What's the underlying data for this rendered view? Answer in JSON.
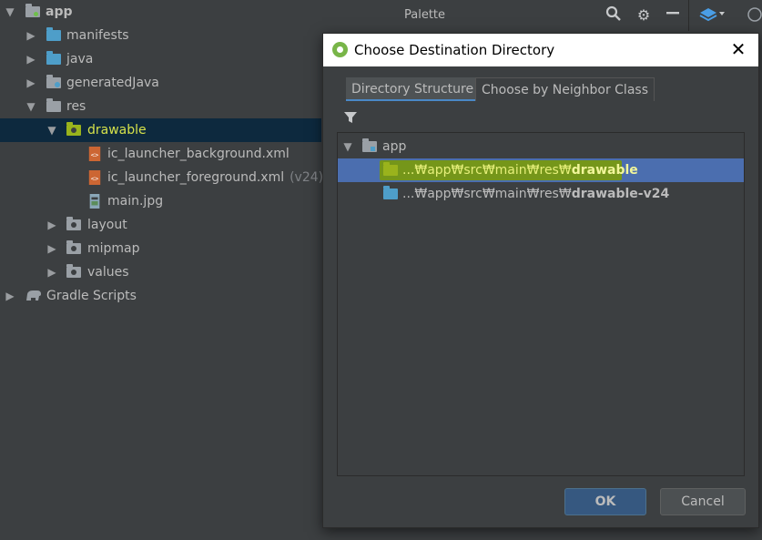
{
  "project_tree": {
    "items": [
      {
        "label": "app"
      },
      {
        "label": "manifests"
      },
      {
        "label": "java"
      },
      {
        "label": "generatedJava"
      },
      {
        "label": "res"
      },
      {
        "label": "drawable"
      },
      {
        "label": "ic_launcher_background.xml"
      },
      {
        "label": "ic_launcher_foreground.xml",
        "suffix": "(v24)"
      },
      {
        "label": "main.jpg"
      },
      {
        "label": "layout"
      },
      {
        "label": "mipmap"
      },
      {
        "label": "values"
      },
      {
        "label": "Gradle Scripts"
      }
    ]
  },
  "palette": {
    "title": "Palette"
  },
  "dialog": {
    "title": "Choose Destination Directory",
    "tabs": [
      {
        "label": "Directory Structure"
      },
      {
        "label": "Choose by Neighbor Class"
      }
    ],
    "tree": {
      "root": "app",
      "rows": [
        {
          "prefix": "...₩app₩src₩main₩res₩",
          "name": "drawable"
        },
        {
          "prefix": "...₩app₩src₩main₩res₩",
          "name": "drawable-v24"
        }
      ]
    },
    "ok_label": "OK",
    "cancel_label": "Cancel"
  },
  "colors": {
    "background": "#3c3f41",
    "selection_blue": "#4b6eaf",
    "highlight_green": "#9ab31c",
    "ok_button": "#365880"
  }
}
